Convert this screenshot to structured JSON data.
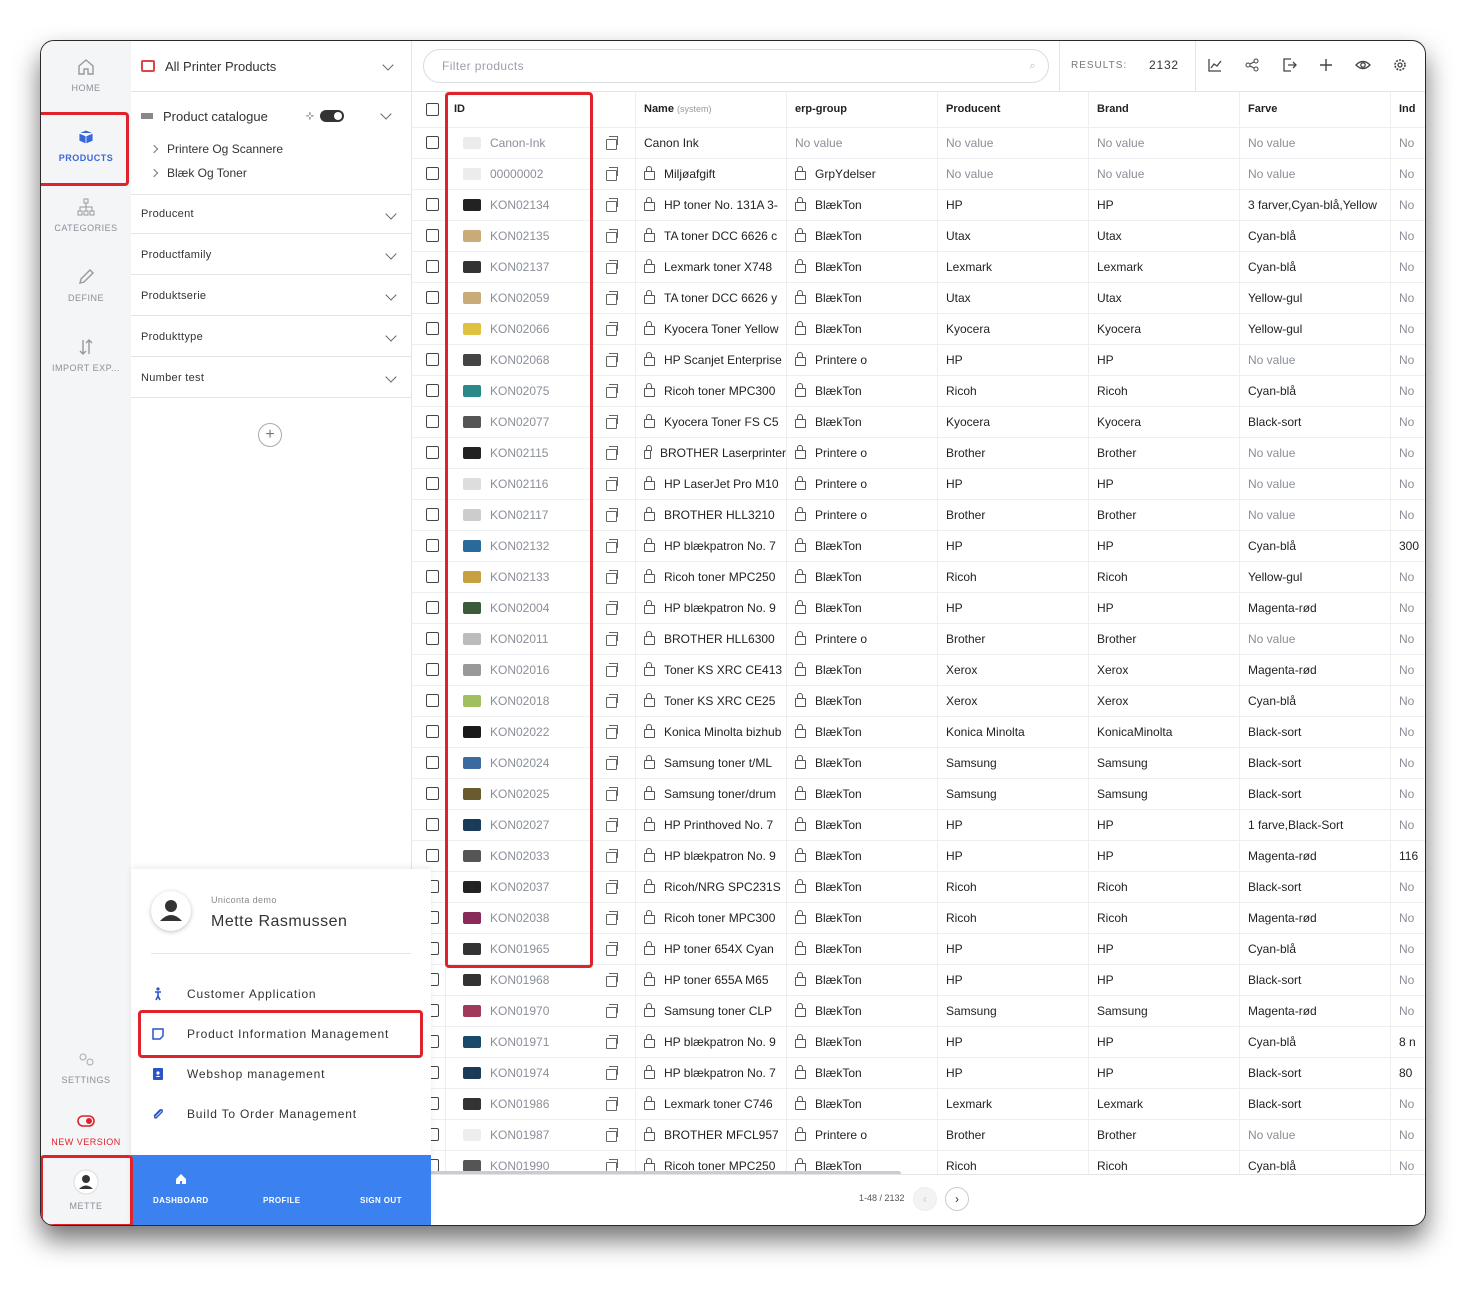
{
  "nav": {
    "home": "HOME",
    "products": "PRODUCTS",
    "categories": "CATEGORIES",
    "define": "DEFINE",
    "import_export": "IMPORT EXP...",
    "settings": "SETTINGS",
    "new_version": "NEW VERSION",
    "user": "METTE"
  },
  "panel": {
    "title": "All Printer Products",
    "catalog_label": "Product catalogue",
    "catalog_items": [
      "Printere Og Scannere",
      "Blæk Og Toner"
    ],
    "facets": [
      "Producent",
      "Productfamily",
      "Produktserie",
      "Produkttype",
      "Number test"
    ]
  },
  "user_menu": {
    "company": "Uniconta demo",
    "name": "Mette Rasmussen",
    "items": [
      "Customer Application",
      "Product Information Management",
      "Webshop management",
      "Build To Order Management"
    ],
    "footer": [
      "DASHBOARD",
      "PROFILE",
      "SIGN OUT"
    ]
  },
  "toolbar": {
    "search_placeholder": "Filter products",
    "results_label": "RESULTS:",
    "results_value": "2132"
  },
  "table": {
    "headers": {
      "id": "ID",
      "name": "Name",
      "name_note": "(system)",
      "erp": "erp-group",
      "producent": "Producent",
      "brand": "Brand",
      "farve": "Farve",
      "ind": "Ind"
    },
    "rows": [
      {
        "id": "Canon-Ink",
        "name": "Canon Ink",
        "erp": "No value",
        "producent": "No value",
        "brand": "No value",
        "farve": "No value",
        "ind": "No",
        "locked": false,
        "thumb": "#ececec"
      },
      {
        "id": "00000002",
        "name": "Miljøafgift",
        "erp": "GrpYdelser",
        "producent": "No value",
        "brand": "No value",
        "farve": "No value",
        "ind": "No",
        "locked": true,
        "thumb": "#ececec"
      },
      {
        "id": "KON02134",
        "name": "HP toner No. 131A 3-",
        "erp": "BlækTon",
        "producent": "HP",
        "brand": "HP",
        "farve": "3 farver,Cyan-blå,Yellow",
        "ind": "No",
        "locked": true,
        "thumb": "#222222"
      },
      {
        "id": "KON02135",
        "name": "TA toner DCC 6626 c",
        "erp": "BlækTon",
        "producent": "Utax",
        "brand": "Utax",
        "farve": "Cyan-blå",
        "ind": "No",
        "locked": true,
        "thumb": "#c9ab7a"
      },
      {
        "id": "KON02137",
        "name": "Lexmark toner X748",
        "erp": "BlækTon",
        "producent": "Lexmark",
        "brand": "Lexmark",
        "farve": "Cyan-blå",
        "ind": "No",
        "locked": true,
        "thumb": "#333333"
      },
      {
        "id": "KON02059",
        "name": "TA toner DCC 6626 y",
        "erp": "BlækTon",
        "producent": "Utax",
        "brand": "Utax",
        "farve": "Yellow-gul",
        "ind": "No",
        "locked": true,
        "thumb": "#c9ab7a"
      },
      {
        "id": "KON02066",
        "name": "Kyocera Toner Yellow",
        "erp": "BlækTon",
        "producent": "Kyocera",
        "brand": "Kyocera",
        "farve": "Yellow-gul",
        "ind": "No",
        "locked": true,
        "thumb": "#e0c040"
      },
      {
        "id": "KON02068",
        "name": "HP Scanjet Enterprise",
        "erp": "Printere o",
        "producent": "HP",
        "brand": "HP",
        "farve": "No value",
        "ind": "No",
        "locked": true,
        "thumb": "#444444"
      },
      {
        "id": "KON02075",
        "name": "Ricoh toner MPC300",
        "erp": "BlækTon",
        "producent": "Ricoh",
        "brand": "Ricoh",
        "farve": "Cyan-blå",
        "ind": "No",
        "locked": true,
        "thumb": "#2a8a8a"
      },
      {
        "id": "KON02077",
        "name": "Kyocera Toner FS C5",
        "erp": "BlækTon",
        "producent": "Kyocera",
        "brand": "Kyocera",
        "farve": "Black-sort",
        "ind": "No",
        "locked": true,
        "thumb": "#555555"
      },
      {
        "id": "KON02115",
        "name": "BROTHER Laserprinter",
        "erp": "Printere o",
        "producent": "Brother",
        "brand": "Brother",
        "farve": "No value",
        "ind": "No",
        "locked": true,
        "thumb": "#222222"
      },
      {
        "id": "KON02116",
        "name": "HP LaserJet Pro M10",
        "erp": "Printere o",
        "producent": "HP",
        "brand": "HP",
        "farve": "No value",
        "ind": "No",
        "locked": true,
        "thumb": "#dddddd"
      },
      {
        "id": "KON02117",
        "name": "BROTHER HLL3210",
        "erp": "Printere o",
        "producent": "Brother",
        "brand": "Brother",
        "farve": "No value",
        "ind": "No",
        "locked": true,
        "thumb": "#cccccc"
      },
      {
        "id": "KON02132",
        "name": "HP blækpatron No. 7",
        "erp": "BlækTon",
        "producent": "HP",
        "brand": "HP",
        "farve": "Cyan-blå",
        "ind": "300",
        "locked": true,
        "thumb": "#2a6a9a"
      },
      {
        "id": "KON02133",
        "name": "Ricoh toner MPC250",
        "erp": "BlækTon",
        "producent": "Ricoh",
        "brand": "Ricoh",
        "farve": "Yellow-gul",
        "ind": "No",
        "locked": true,
        "thumb": "#c8a040"
      },
      {
        "id": "KON02004",
        "name": "HP blækpatron No. 9",
        "erp": "BlækTon",
        "producent": "HP",
        "brand": "HP",
        "farve": "Magenta-rød",
        "ind": "No",
        "locked": true,
        "thumb": "#3a5a3a"
      },
      {
        "id": "KON02011",
        "name": "BROTHER HLL6300",
        "erp": "Printere o",
        "producent": "Brother",
        "brand": "Brother",
        "farve": "No value",
        "ind": "No",
        "locked": true,
        "thumb": "#bbbbbb"
      },
      {
        "id": "KON02016",
        "name": "Toner KS XRC CE413",
        "erp": "BlækTon",
        "producent": "Xerox",
        "brand": "Xerox",
        "farve": "Magenta-rød",
        "ind": "No",
        "locked": true,
        "thumb": "#999999"
      },
      {
        "id": "KON02018",
        "name": "Toner KS XRC CE25",
        "erp": "BlækTon",
        "producent": "Xerox",
        "brand": "Xerox",
        "farve": "Cyan-blå",
        "ind": "No",
        "locked": true,
        "thumb": "#a0c060"
      },
      {
        "id": "KON02022",
        "name": "Konica Minolta bizhub",
        "erp": "BlækTon",
        "producent": "Konica Minolta",
        "brand": "KonicaMinolta",
        "farve": "Black-sort",
        "ind": "No",
        "locked": true,
        "thumb": "#1a1a1a"
      },
      {
        "id": "KON02024",
        "name": "Samsung toner t/ML",
        "erp": "BlækTon",
        "producent": "Samsung",
        "brand": "Samsung",
        "farve": "Black-sort",
        "ind": "No",
        "locked": true,
        "thumb": "#3a6aa0"
      },
      {
        "id": "KON02025",
        "name": "Samsung toner/drum",
        "erp": "BlækTon",
        "producent": "Samsung",
        "brand": "Samsung",
        "farve": "Black-sort",
        "ind": "No",
        "locked": true,
        "thumb": "#6a5a30"
      },
      {
        "id": "KON02027",
        "name": "HP Printhoved No. 7",
        "erp": "BlækTon",
        "producent": "HP",
        "brand": "HP",
        "farve": "1 farve,Black-Sort",
        "ind": "No",
        "locked": true,
        "thumb": "#1a3a5a"
      },
      {
        "id": "KON02033",
        "name": "HP blækpatron No. 9",
        "erp": "BlækTon",
        "producent": "HP",
        "brand": "HP",
        "farve": "Magenta-rød",
        "ind": "116",
        "locked": true,
        "thumb": "#555555"
      },
      {
        "id": "KON02037",
        "name": "Ricoh/NRG SPC231S",
        "erp": "BlækTon",
        "producent": "Ricoh",
        "brand": "Ricoh",
        "farve": "Black-sort",
        "ind": "No",
        "locked": true,
        "thumb": "#222222"
      },
      {
        "id": "KON02038",
        "name": "Ricoh toner MPC300",
        "erp": "BlækTon",
        "producent": "Ricoh",
        "brand": "Ricoh",
        "farve": "Magenta-rød",
        "ind": "No",
        "locked": true,
        "thumb": "#8a2a5a"
      },
      {
        "id": "KON01965",
        "name": "HP toner 654X Cyan",
        "erp": "BlækTon",
        "producent": "HP",
        "brand": "HP",
        "farve": "Cyan-blå",
        "ind": "No",
        "locked": true,
        "thumb": "#333333"
      },
      {
        "id": "KON01968",
        "name": "HP toner 655A M65",
        "erp": "BlækTon",
        "producent": "HP",
        "brand": "HP",
        "farve": "Black-sort",
        "ind": "No",
        "locked": true,
        "thumb": "#333333"
      },
      {
        "id": "KON01970",
        "name": "Samsung toner CLP",
        "erp": "BlækTon",
        "producent": "Samsung",
        "brand": "Samsung",
        "farve": "Magenta-rød",
        "ind": "No",
        "locked": true,
        "thumb": "#a03a5a"
      },
      {
        "id": "KON01971",
        "name": "HP blækpatron No. 9",
        "erp": "BlækTon",
        "producent": "HP",
        "brand": "HP",
        "farve": "Cyan-blå",
        "ind": "8 n",
        "locked": true,
        "thumb": "#1a4a6a"
      },
      {
        "id": "KON01974",
        "name": "HP blækpatron No. 7",
        "erp": "BlækTon",
        "producent": "HP",
        "brand": "HP",
        "farve": "Black-sort",
        "ind": "80",
        "locked": true,
        "thumb": "#1a3a5a"
      },
      {
        "id": "KON01986",
        "name": "Lexmark toner C746",
        "erp": "BlækTon",
        "producent": "Lexmark",
        "brand": "Lexmark",
        "farve": "Black-sort",
        "ind": "No",
        "locked": true,
        "thumb": "#333333"
      },
      {
        "id": "KON01987",
        "name": "BROTHER MFCL957",
        "erp": "Printere o",
        "producent": "Brother",
        "brand": "Brother",
        "farve": "No value",
        "ind": "No",
        "locked": true,
        "thumb": "#eeeeee"
      },
      {
        "id": "KON01990",
        "name": "Ricoh toner MPC250",
        "erp": "BlækTon",
        "producent": "Ricoh",
        "brand": "Ricoh",
        "farve": "Cyan-blå",
        "ind": "No",
        "locked": true,
        "thumb": "#555555"
      }
    ]
  },
  "pagination": {
    "range": "1-48 / 2132",
    "prev": "‹",
    "next": "›"
  },
  "colors": {
    "accent": "#3b82f0",
    "highlight": "#e0232b"
  }
}
